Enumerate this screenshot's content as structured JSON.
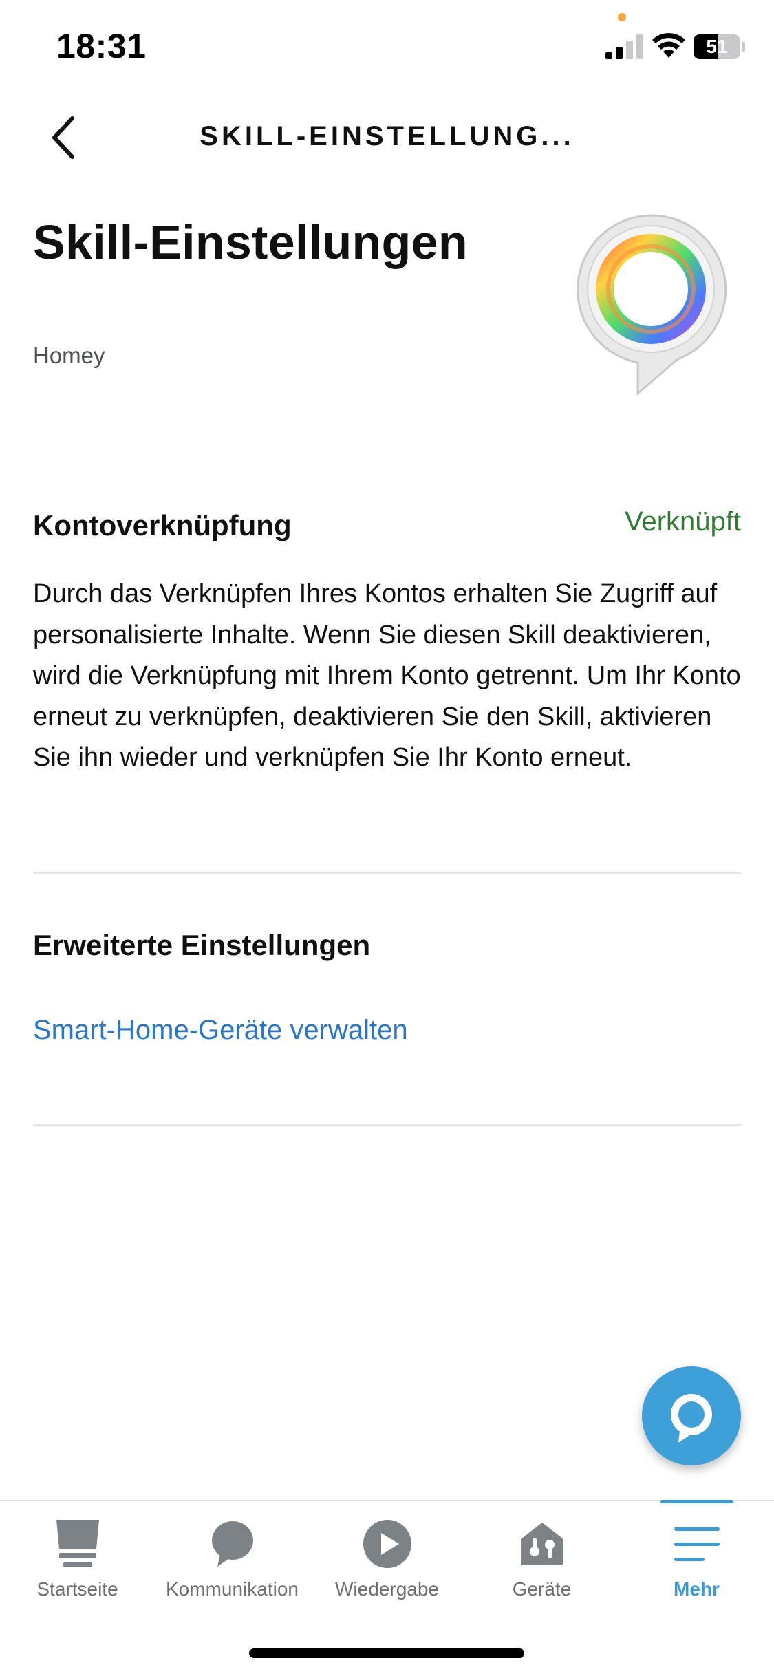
{
  "status_bar": {
    "time": "18:31",
    "battery_level": "51"
  },
  "header": {
    "back_icon": "chevron-left-icon",
    "title": "SKILL-EINSTELLUNG..."
  },
  "hero": {
    "title": "Skill-Einstellungen",
    "provider": "Homey",
    "logo_icon": "homey-skill-logo"
  },
  "account_linking": {
    "heading": "Kontoverknüpfung",
    "status": "Verknüpft",
    "status_color": "#2e7d32",
    "description": "Durch das Verknüpfen Ihres Kontos erhalten Sie Zugriff auf personalisierte Inhalte. Wenn Sie diesen Skill deaktivieren, wird die Verknüpfung mit Ihrem Konto getrennt. Um Ihr Konto erneut zu verknüpfen, deaktivieren Sie den Skill, aktivieren Sie ihn wieder und verknüpfen Sie Ihr Konto erneut."
  },
  "advanced": {
    "heading": "Erweiterte Einstellungen",
    "manage_link": "Smart-Home-Geräte verwalten",
    "link_color": "#2a77c7"
  },
  "fab": {
    "icon": "alexa-icon",
    "color": "#3f9fd8"
  },
  "tabs": [
    {
      "label": "Startseite",
      "icon": "home-icon"
    },
    {
      "label": "Kommunikation",
      "icon": "chat-bubble-icon"
    },
    {
      "label": "Wiedergabe",
      "icon": "play-icon"
    },
    {
      "label": "Geräte",
      "icon": "devices-icon"
    },
    {
      "label": "Mehr",
      "icon": "menu-icon",
      "active": true
    }
  ],
  "accent_color": "#3a9bd6"
}
